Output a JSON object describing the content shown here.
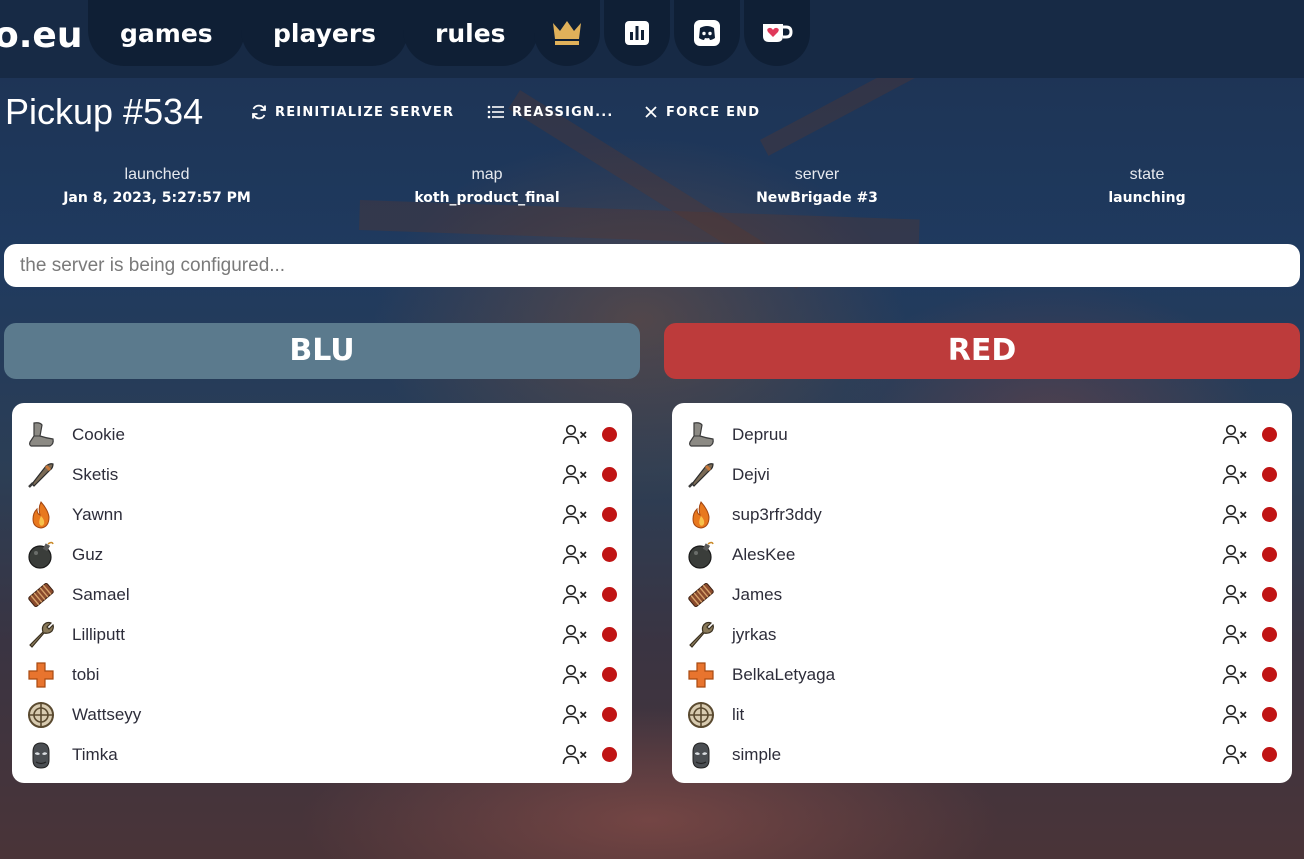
{
  "brand": {
    "text": "o.eu"
  },
  "nav": {
    "items": [
      {
        "label": "games"
      },
      {
        "label": "players"
      },
      {
        "label": "rules"
      }
    ],
    "icons": [
      "crown-icon",
      "stats-icon",
      "discord-icon",
      "kofi-cup-icon"
    ]
  },
  "game": {
    "title": "Pickup #534",
    "actions": {
      "reinitialize": "REINITIALIZE SERVER",
      "reassign": "REASSIGN...",
      "force_end": "FORCE END"
    },
    "info": {
      "launched_label": "launched",
      "launched_value": "Jan 8, 2023, 5:27:57 PM",
      "map_label": "map",
      "map_value": "koth_product_final",
      "server_label": "server",
      "server_value": "NewBrigade #3",
      "state_label": "state",
      "state_value": "launching"
    },
    "status_text": "the server is being configured..."
  },
  "teams": {
    "blu": {
      "name": "BLU",
      "color": "#5b7a8d",
      "players": [
        {
          "class": "scout",
          "name": "Cookie"
        },
        {
          "class": "soldier",
          "name": "Sketis"
        },
        {
          "class": "pyro",
          "name": "Yawnn"
        },
        {
          "class": "demoman",
          "name": "Guz"
        },
        {
          "class": "heavy",
          "name": "Samael"
        },
        {
          "class": "engineer",
          "name": "Lilliputt"
        },
        {
          "class": "medic",
          "name": "tobi"
        },
        {
          "class": "sniper",
          "name": "Wattseyy"
        },
        {
          "class": "spy",
          "name": "Timka"
        }
      ]
    },
    "red": {
      "name": "RED",
      "color": "#bd3b3b",
      "players": [
        {
          "class": "scout",
          "name": "Depruu"
        },
        {
          "class": "soldier",
          "name": "Dejvi"
        },
        {
          "class": "pyro",
          "name": "sup3rfr3ddy"
        },
        {
          "class": "demoman",
          "name": "AlesKee"
        },
        {
          "class": "heavy",
          "name": "James"
        },
        {
          "class": "engineer",
          "name": "jyrkas"
        },
        {
          "class": "medic",
          "name": "BelkaLetyaga"
        },
        {
          "class": "sniper",
          "name": "lit"
        },
        {
          "class": "spy",
          "name": "simple"
        }
      ]
    }
  },
  "colors": {
    "navbar": "#172a45",
    "nav_tab": "#0f1f35",
    "crown": "#e0b15a",
    "offline_dot": "#c01414"
  }
}
